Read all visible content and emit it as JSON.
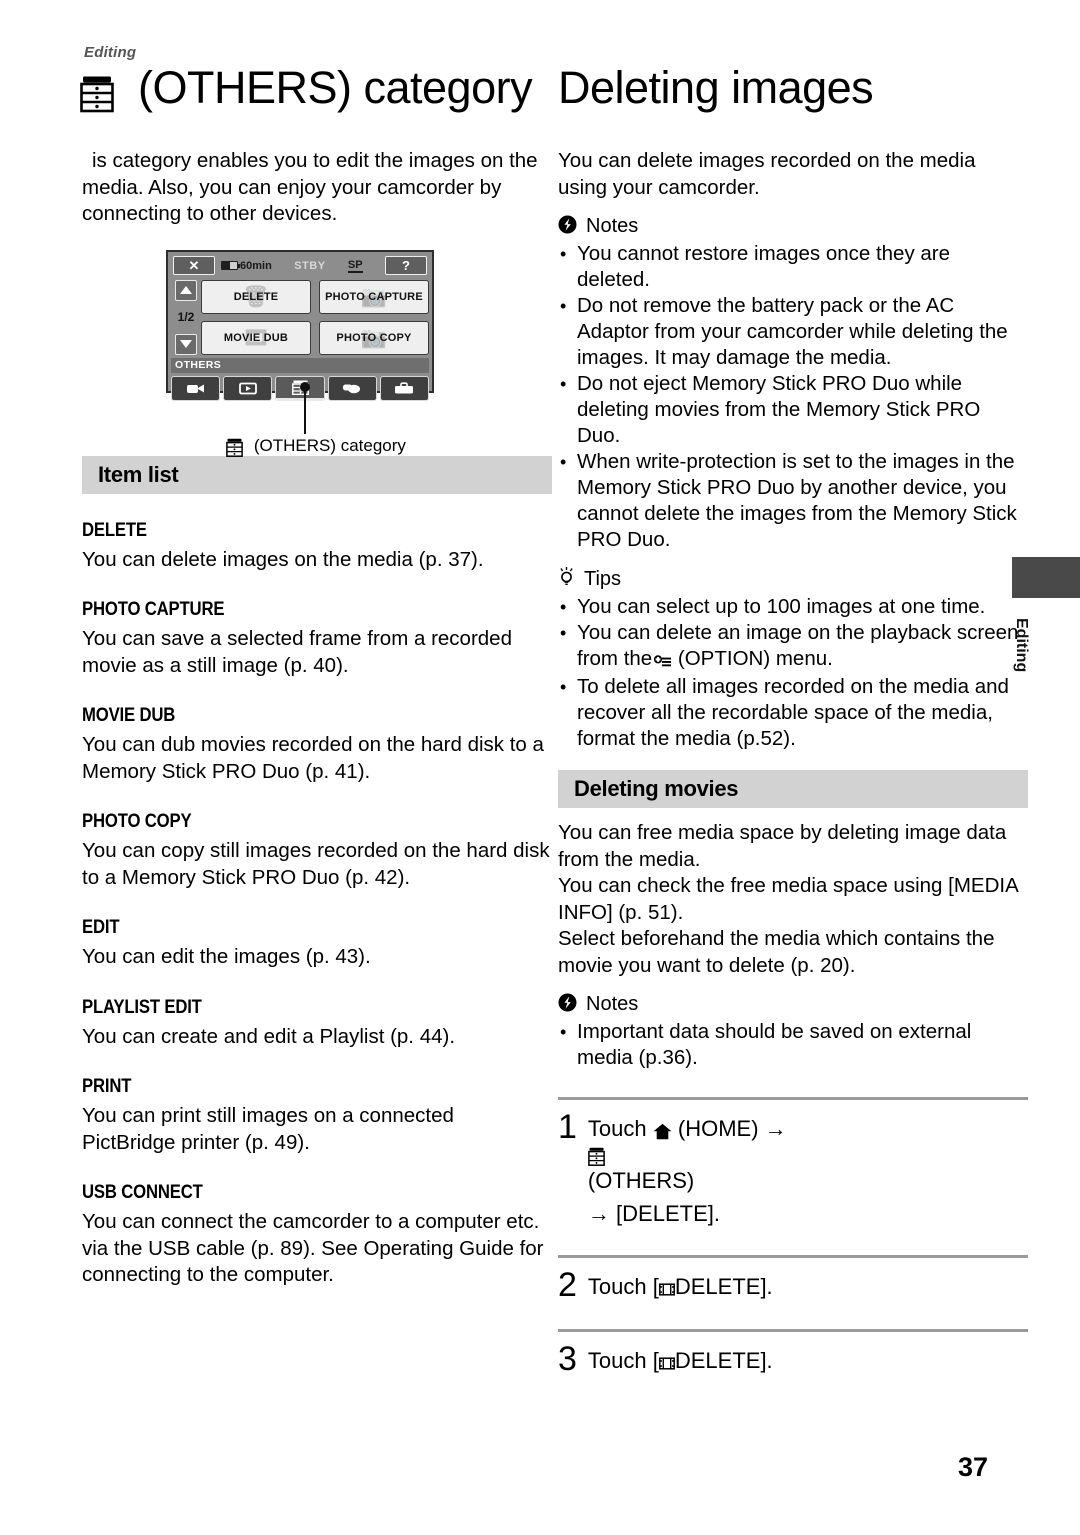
{
  "page": {
    "running_head": "Editing",
    "page_number": "37",
    "edge_tab_label": "Editing"
  },
  "titles": {
    "left": "(OTHERS) category",
    "left_icon": "others-category-icon",
    "right": "Deleting images"
  },
  "left_column": {
    "intro": "is category enables you to edit the images on the media. Also, you can enjoy your camcorder by connecting to other devices.",
    "figure": {
      "caption": "(OTHERS) category",
      "caption_icon": "others-category-icon",
      "screen": {
        "close_button": "✕",
        "battery": "60min",
        "status": "STBY",
        "quality": "SP",
        "help_button": "?",
        "page_indicator": "1/2",
        "up_arrow": "scroll-up-arrow",
        "down_arrow": "scroll-down-arrow",
        "menu_items": [
          {
            "label": "DELETE",
            "ghost": "trash-ghost-icon"
          },
          {
            "label": "PHOTO CAPTURE",
            "ghost": "camera-ghost-icon"
          },
          {
            "label": "MOVIE DUB",
            "ghost": "film-ghost-icon"
          },
          {
            "label": "PHOTO COPY",
            "ghost": "camera-ghost-icon"
          }
        ],
        "category_label": "OTHERS",
        "tabs": [
          {
            "name": "camera-tab",
            "icon": "camcorder-icon"
          },
          {
            "name": "playback-tab",
            "icon": "play-icon"
          },
          {
            "name": "others-tab",
            "icon": "others-category-icon",
            "active": true
          },
          {
            "name": "manage-media-tab",
            "icon": "media-icon"
          },
          {
            "name": "settings-tab",
            "icon": "toolbox-icon"
          }
        ]
      }
    },
    "section_title": "Item list",
    "items": [
      {
        "heading": "DELETE",
        "body": "You can delete images on the media (p. 37)."
      },
      {
        "heading": "PHOTO CAPTURE",
        "body": "You can save a selected frame from a recorded movie as a still image (p. 40)."
      },
      {
        "heading": "MOVIE DUB",
        "body": "You can dub movies recorded on the hard disk to a Memory Stick PRO Duo (p. 41)."
      },
      {
        "heading": "PHOTO COPY",
        "body": "You can copy still images recorded on the hard disk to a Memory Stick PRO Duo (p. 42)."
      },
      {
        "heading": "EDIT",
        "body": "You can edit the images (p. 43)."
      },
      {
        "heading": "PLAYLIST EDIT",
        "body": "You can create and edit a Playlist (p. 44)."
      },
      {
        "heading": "PRINT",
        "body": "You can print still images on a connected PictBridge printer (p. 49)."
      },
      {
        "heading": "USB CONNECT",
        "body": "You can connect the camcorder to a computer etc. via the USB cable (p. 89). See Operating Guide for connecting to the computer."
      }
    ]
  },
  "right_column": {
    "intro": "You can delete images recorded on the media using your camcorder.",
    "notes_label": "Notes",
    "notes_icon": "notes-warning-icon",
    "notes": [
      "You cannot restore images once they are deleted.",
      "Do not remove the battery pack or the AC Adaptor from your camcorder while deleting the images. It may damage the media.",
      "Do not eject Memory Stick PRO Duo while deleting movies from the Memory Stick PRO Duo.",
      "When write-protection is set to the images in the Memory Stick PRO Duo by another device, you cannot delete the images from the Memory Stick PRO Duo."
    ],
    "tips_label": "Tips",
    "tips_icon": "tips-bulb-icon",
    "tips": [
      {
        "text": "You can select up to 100 images at one time."
      },
      {
        "pre": "You can delete an image on the playback screen from the",
        "icon": "option-menu-icon",
        "post": "(OPTION) menu."
      },
      {
        "text": "To delete all images recorded on the media and recover all the recordable space of the media, format the media (p.52)."
      }
    ],
    "section_title": "Deleting movies",
    "deleting_movies_body": "You can free media space by deleting image data from the media.\nYou can check the free media space using [MEDIA INFO] (p. 51).\nSelect beforehand the media which contains the movie you want to delete (p. 20).",
    "notes2_label": "Notes",
    "notes2_icon": "notes-warning-icon",
    "notes2": [
      "Important data should be saved on external media (p.36)."
    ],
    "steps": [
      {
        "number": "1",
        "pre": "Touch",
        "icon1": "home-icon",
        "mid1": "(HOME)",
        "arrow1": "→",
        "icon2": "others-category-icon",
        "mid2": "(OTHERS)",
        "arrow2": "→",
        "post": "[DELETE]."
      },
      {
        "number": "2",
        "pre": "Touch [",
        "icon1": "film-icon",
        "post": "DELETE]."
      },
      {
        "number": "3",
        "pre": "Touch [",
        "icon1": "film-icon",
        "post": "DELETE]."
      }
    ]
  },
  "colors": {
    "section_bar": "#d2d2d2",
    "edge_tab": "#494949",
    "lcd_body": "#8d8d8d"
  }
}
